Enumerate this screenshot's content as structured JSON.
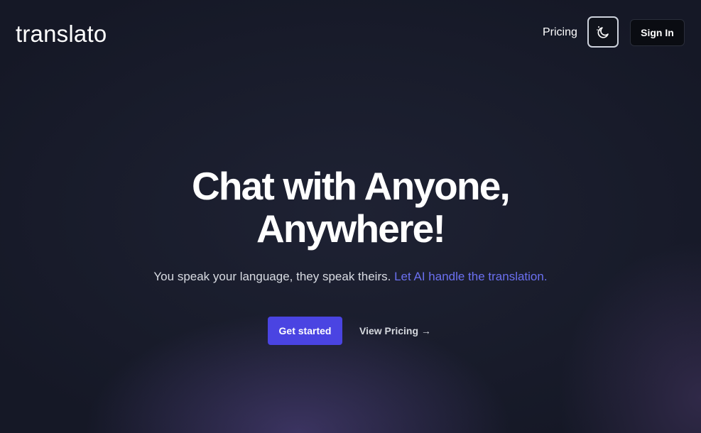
{
  "header": {
    "logo": "translato",
    "nav_pricing": "Pricing",
    "theme_toggle_icon": "moon-stars-icon",
    "sign_in": "Sign In"
  },
  "hero": {
    "title_line1": "Chat with Anyone,",
    "title_line2": "Anywhere!",
    "subtitle_plain": "You speak your language, they speak theirs.",
    "subtitle_accent": "Let AI handle the translation.",
    "cta_label": "Get started",
    "secondary_label": "View Pricing →"
  },
  "colors": {
    "background": "#151826",
    "accent": "#6b70f0",
    "cta": "#4a44e2"
  }
}
